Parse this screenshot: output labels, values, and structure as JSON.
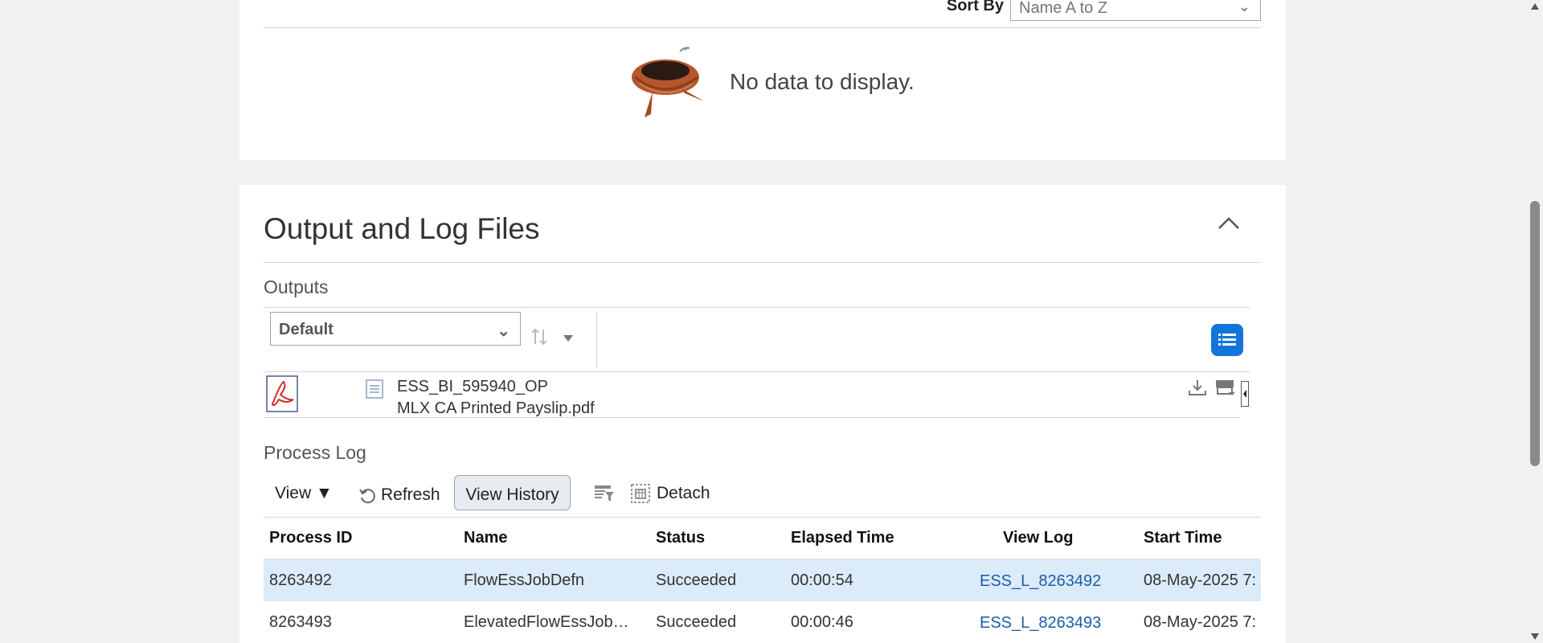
{
  "sort": {
    "label": "Sort By",
    "value": "Name A to Z"
  },
  "empty_state": {
    "message": "No data to display."
  },
  "section": {
    "title": "Output and Log Files"
  },
  "outputs": {
    "label": "Outputs",
    "view_value": "Default",
    "file": {
      "name_line1": "ESS_BI_595940_OP",
      "name_line2": "MLX CA Printed Payslip.pdf"
    }
  },
  "process_log": {
    "label": "Process Log",
    "toolbar": {
      "view": "View ▼",
      "refresh": "Refresh",
      "view_history": "View History",
      "detach": "Detach"
    },
    "columns": [
      "Process ID",
      "Name",
      "Status",
      "Elapsed Time",
      "View Log",
      "Start Time"
    ],
    "rows": [
      {
        "id": "8263492",
        "name": "FlowEssJobDefn",
        "status": "Succeeded",
        "elapsed": "00:00:54",
        "log": "ESS_L_8263492",
        "start": "08-May-2025 7:"
      },
      {
        "id": "8263493",
        "name": "ElevatedFlowEssJob…",
        "status": "Succeeded",
        "elapsed": "00:00:46",
        "log": "ESS_L_8263493",
        "start": "08-May-2025 7:"
      }
    ]
  },
  "colors": {
    "accent": "#1475d8",
    "link": "#1a5fa8",
    "selected_row": "#dcebf9"
  }
}
